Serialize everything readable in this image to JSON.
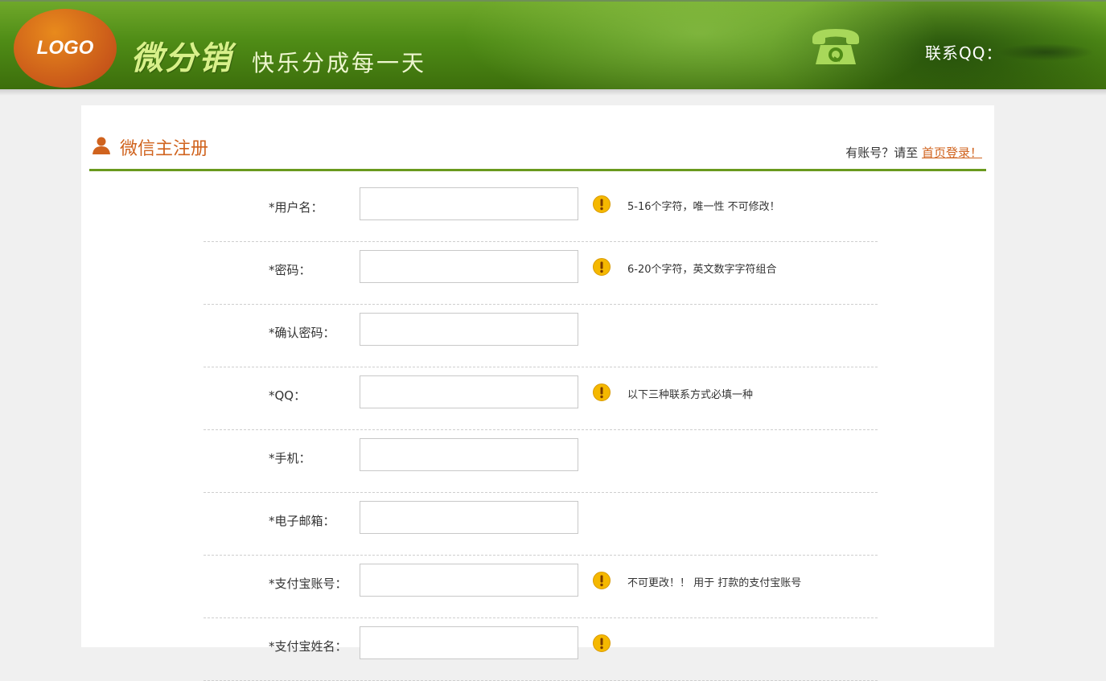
{
  "header": {
    "logo_text": "LOGO",
    "brand": "微分销",
    "slogan": "快乐分成每一天",
    "contact_label": "联系QQ："
  },
  "panel": {
    "title": "微信主注册",
    "login_prompt": "有账号？请至",
    "login_link": "首页登录！"
  },
  "form": {
    "rows": [
      {
        "label": "*用户名：",
        "value": "",
        "hint": "5-16个字符，唯一性 不可修改！",
        "has_warning": true
      },
      {
        "label": "*密码：",
        "value": "",
        "hint": "6-20个字符，英文数字字符组合",
        "has_warning": true
      },
      {
        "label": "*确认密码：",
        "value": "",
        "hint": "",
        "has_warning": false
      },
      {
        "label": "*QQ：",
        "value": "",
        "hint": "以下三种联系方式必填一种",
        "has_warning": true
      },
      {
        "label": "*手机：",
        "value": "",
        "hint": "",
        "has_warning": false
      },
      {
        "label": "*电子邮箱：",
        "value": "",
        "hint": "",
        "has_warning": false
      },
      {
        "label": "*支付宝账号：",
        "value": "",
        "hint": "不可更改！！ 用于 打款的支付宝账号",
        "has_warning": true
      },
      {
        "label": "*支付宝姓名：",
        "value": "",
        "hint": "",
        "has_warning": true
      }
    ]
  },
  "colors": {
    "accent_orange": "#d0631e",
    "accent_green": "#6a9a1e",
    "warning_yellow": "#f5b800"
  },
  "icons": [
    "phone-icon",
    "user-icon",
    "warning-icon"
  ]
}
